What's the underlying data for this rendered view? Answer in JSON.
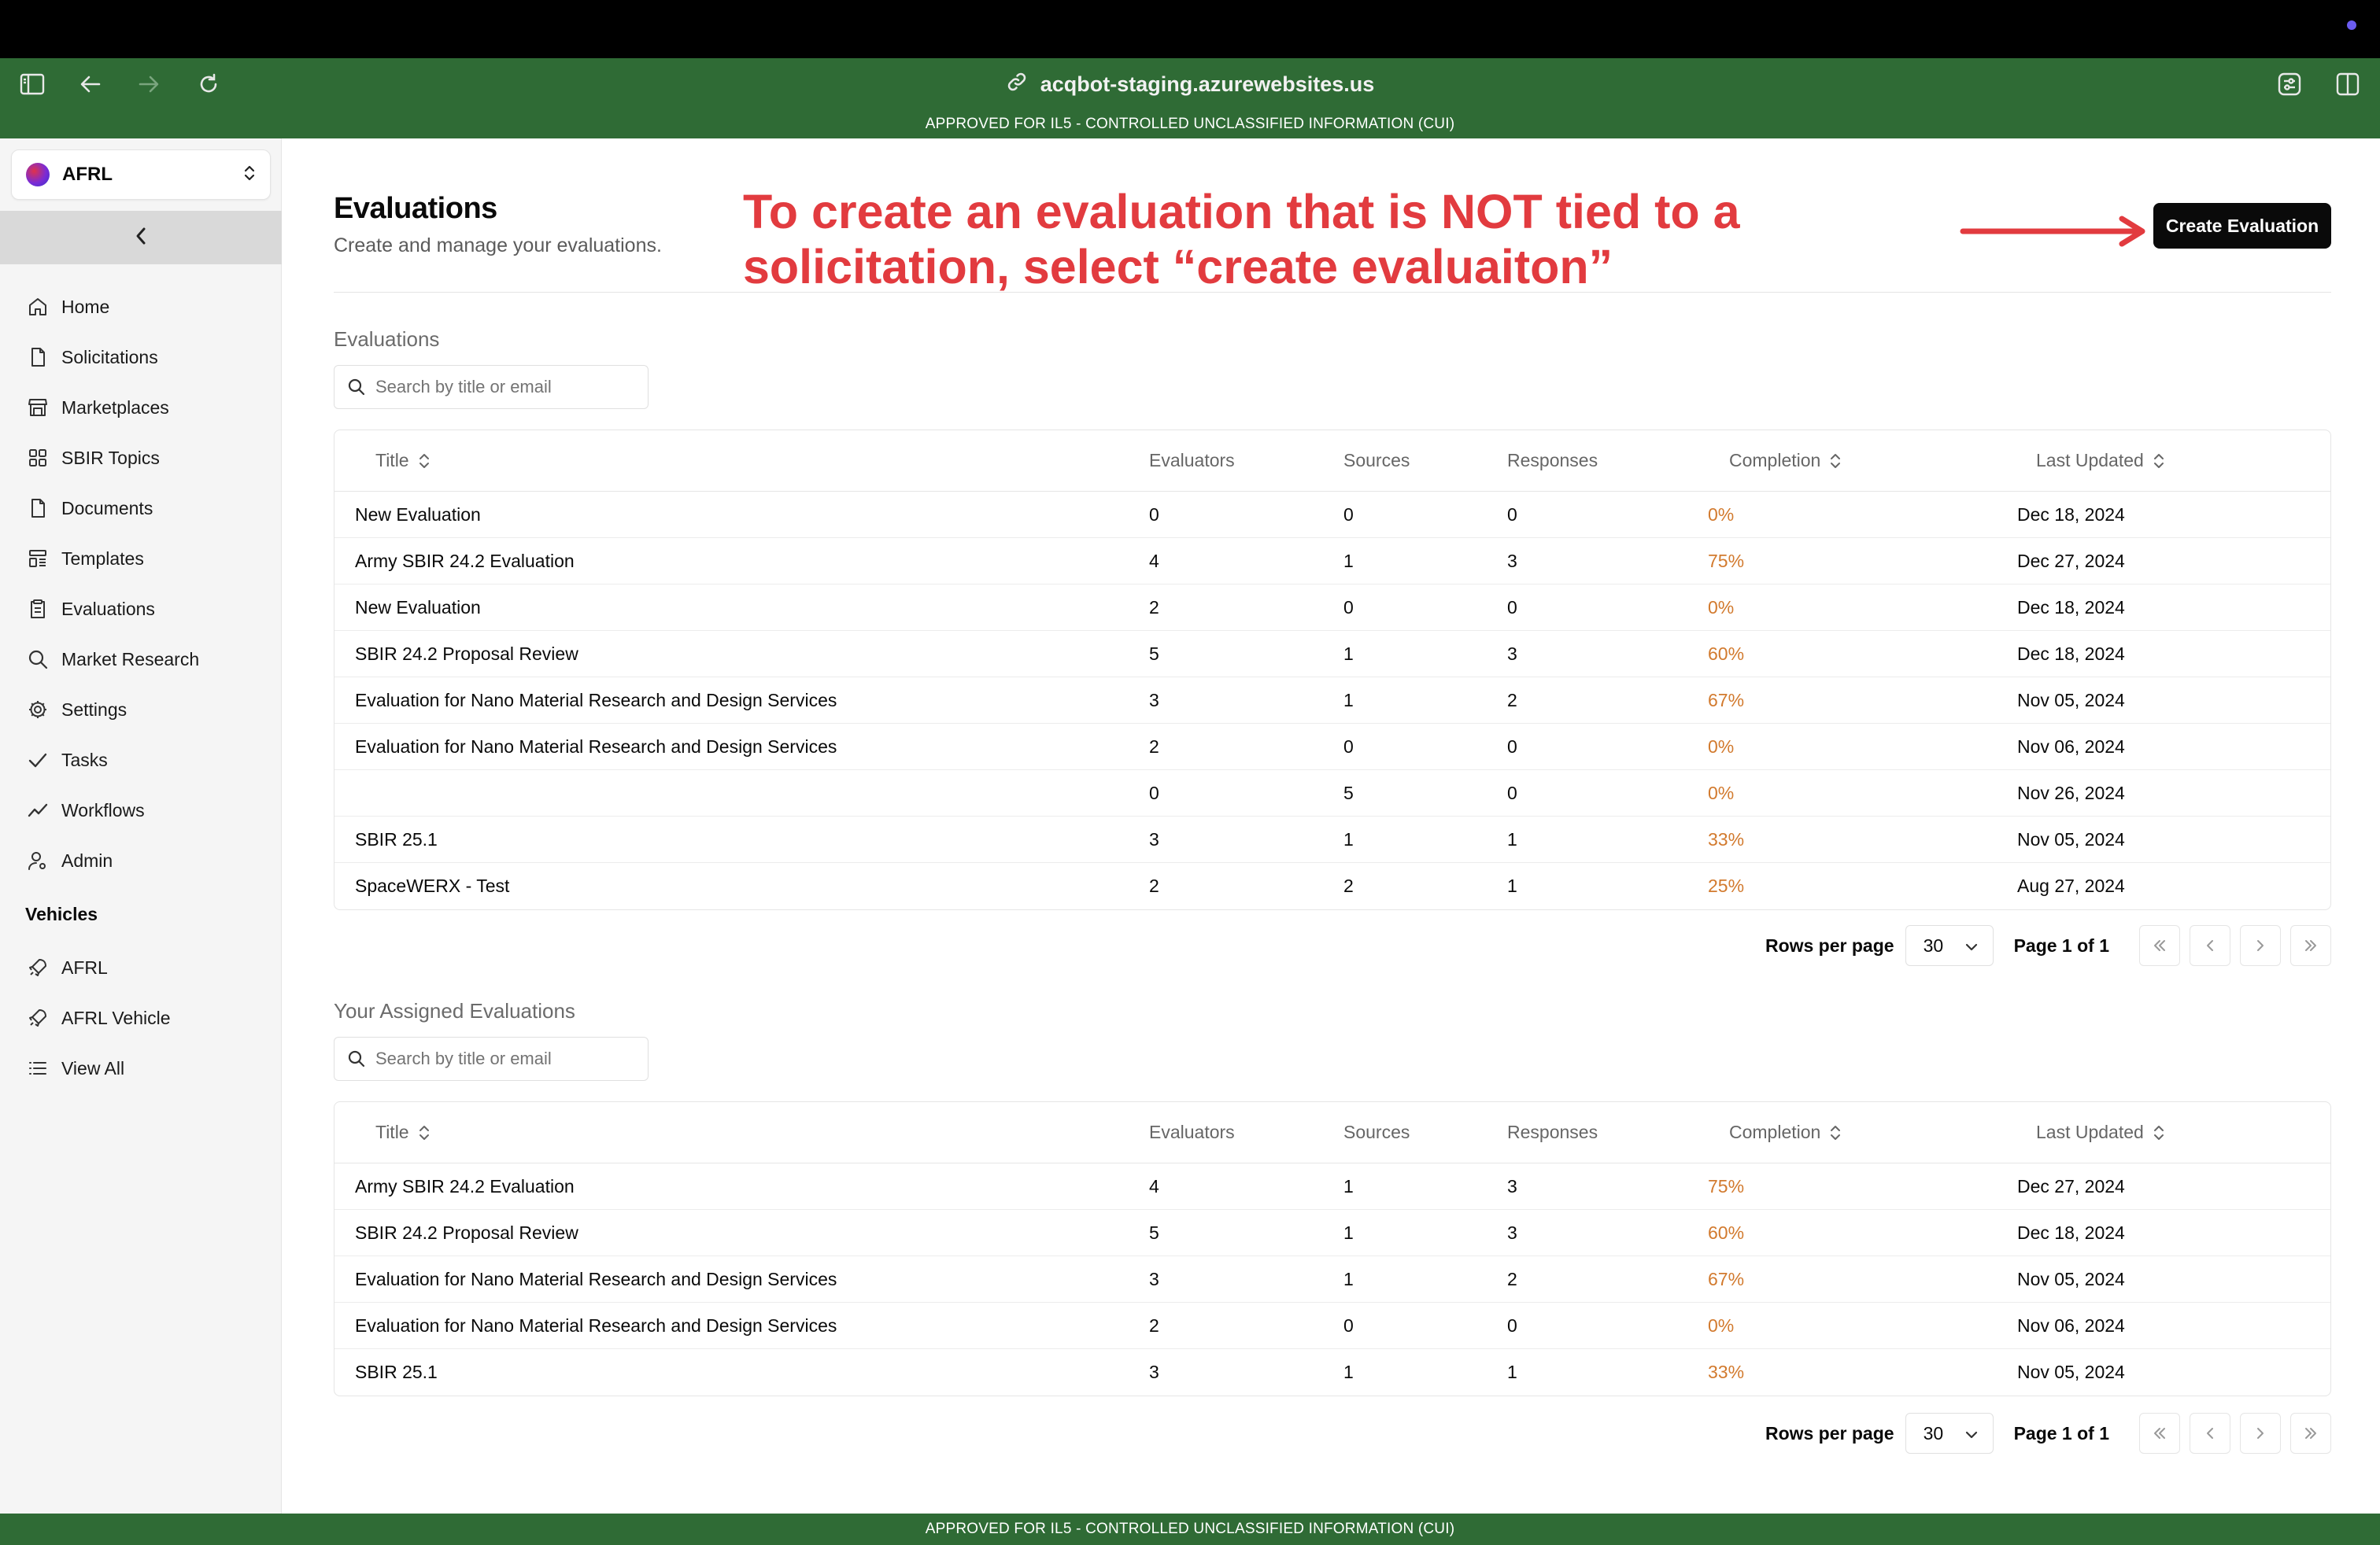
{
  "browser": {
    "url": "acqbot-staging.azurewebsites.us"
  },
  "banner": {
    "top": "APPROVED FOR IL5 - CONTROLLED UNCLASSIFIED INFORMATION (CUI)",
    "bottom": "APPROVED FOR IL5 - CONTROLLED UNCLASSIFIED INFORMATION (CUI)"
  },
  "sidebar": {
    "org": "AFRL",
    "items": [
      {
        "label": "Home",
        "icon": "home-icon"
      },
      {
        "label": "Solicitations",
        "icon": "file-icon"
      },
      {
        "label": "Marketplaces",
        "icon": "store-icon"
      },
      {
        "label": "SBIR Topics",
        "icon": "grid-icon"
      },
      {
        "label": "Documents",
        "icon": "file-icon"
      },
      {
        "label": "Templates",
        "icon": "template-icon"
      },
      {
        "label": "Evaluations",
        "icon": "clipboard-icon"
      },
      {
        "label": "Market Research",
        "icon": "search-icon"
      },
      {
        "label": "Settings",
        "icon": "gear-icon"
      },
      {
        "label": "Tasks",
        "icon": "check-icon"
      },
      {
        "label": "Workflows",
        "icon": "trend-icon"
      },
      {
        "label": "Admin",
        "icon": "user-gear-icon"
      }
    ],
    "vehicles_heading": "Vehicles",
    "vehicles": [
      {
        "label": "AFRL",
        "icon": "rocket-icon"
      },
      {
        "label": "AFRL Vehicle",
        "icon": "rocket-icon"
      },
      {
        "label": "View All",
        "icon": "list-icon"
      }
    ]
  },
  "page": {
    "title": "Evaluations",
    "subtitle": "Create and manage your evaluations.",
    "annotation": "To create an evaluation that is NOT tied to a solicitation, select “create evaluaiton”",
    "create_button": "Create Evaluation"
  },
  "columns": {
    "title": "Title",
    "evaluators": "Evaluators",
    "sources": "Sources",
    "responses": "Responses",
    "completion": "Completion",
    "last_updated": "Last Updated"
  },
  "evaluations": {
    "label": "Evaluations",
    "search_placeholder": "Search by title or email",
    "rows": [
      {
        "title": "New Evaluation",
        "evaluators": "0",
        "sources": "0",
        "responses": "0",
        "completion": "0%",
        "updated": "Dec 18, 2024"
      },
      {
        "title": "Army SBIR 24.2 Evaluation",
        "evaluators": "4",
        "sources": "1",
        "responses": "3",
        "completion": "75%",
        "updated": "Dec 27, 2024"
      },
      {
        "title": "New Evaluation",
        "evaluators": "2",
        "sources": "0",
        "responses": "0",
        "completion": "0%",
        "updated": "Dec 18, 2024"
      },
      {
        "title": "SBIR 24.2 Proposal Review",
        "evaluators": "5",
        "sources": "1",
        "responses": "3",
        "completion": "60%",
        "updated": "Dec 18, 2024"
      },
      {
        "title": "Evaluation for Nano Material Research and Design Services",
        "evaluators": "3",
        "sources": "1",
        "responses": "2",
        "completion": "67%",
        "updated": "Nov 05, 2024"
      },
      {
        "title": "Evaluation for Nano Material Research and Design Services",
        "evaluators": "2",
        "sources": "0",
        "responses": "0",
        "completion": "0%",
        "updated": "Nov 06, 2024"
      },
      {
        "title": "",
        "evaluators": "0",
        "sources": "5",
        "responses": "0",
        "completion": "0%",
        "updated": "Nov 26, 2024"
      },
      {
        "title": "SBIR 25.1",
        "evaluators": "3",
        "sources": "1",
        "responses": "1",
        "completion": "33%",
        "updated": "Nov 05, 2024"
      },
      {
        "title": "SpaceWERX - Test",
        "evaluators": "2",
        "sources": "2",
        "responses": "1",
        "completion": "25%",
        "updated": "Aug 27, 2024"
      }
    ],
    "pager": {
      "rows_per_page_label": "Rows per page",
      "rows_per_page": "30",
      "page_info": "Page 1 of 1"
    }
  },
  "assigned": {
    "label": "Your Assigned Evaluations",
    "search_placeholder": "Search by title or email",
    "rows": [
      {
        "title": "Army SBIR 24.2 Evaluation",
        "evaluators": "4",
        "sources": "1",
        "responses": "3",
        "completion": "75%",
        "updated": "Dec 27, 2024"
      },
      {
        "title": "SBIR 24.2 Proposal Review",
        "evaluators": "5",
        "sources": "1",
        "responses": "3",
        "completion": "60%",
        "updated": "Dec 18, 2024"
      },
      {
        "title": "Evaluation for Nano Material Research and Design Services",
        "evaluators": "3",
        "sources": "1",
        "responses": "2",
        "completion": "67%",
        "updated": "Nov 05, 2024"
      },
      {
        "title": "Evaluation for Nano Material Research and Design Services",
        "evaluators": "2",
        "sources": "0",
        "responses": "0",
        "completion": "0%",
        "updated": "Nov 06, 2024"
      },
      {
        "title": "SBIR 25.1",
        "evaluators": "3",
        "sources": "1",
        "responses": "1",
        "completion": "33%",
        "updated": "Nov 05, 2024"
      }
    ],
    "pager": {
      "rows_per_page_label": "Rows per page",
      "rows_per_page": "30",
      "page_info": "Page 1 of 1"
    }
  },
  "colors": {
    "banner_green": "#2f6b35",
    "annotation_red": "#e23b3f",
    "completion_orange": "#d27a2e"
  }
}
